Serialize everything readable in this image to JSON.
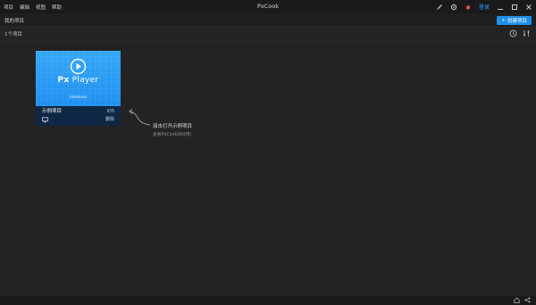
{
  "menu": [
    "项目",
    "编辑",
    "视图",
    "帮助"
  ],
  "app_title": "PxCook",
  "titlebar": {
    "login_label": "登录"
  },
  "subbar": {
    "crumb": "我的项目",
    "new_button_label": "创建项目"
  },
  "toolbar": {
    "count_label": "1个项目"
  },
  "project_card": {
    "thumb_title_bold": "Px",
    "thumb_title_rest": " Player",
    "thumb_subtitle": "Usemore",
    "name": "示例项目",
    "platform": "iOS",
    "action": "删除",
    "brand_color": "#1f8ff1"
  },
  "hint": {
    "title": "双击打开示例项目",
    "subtitle": "查看PxCook的好用!"
  }
}
